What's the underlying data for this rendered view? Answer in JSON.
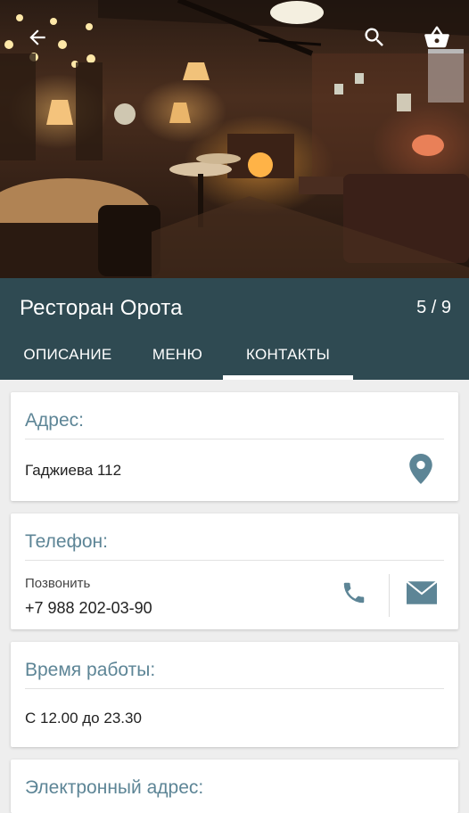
{
  "hero": {
    "back_icon": "arrow-left-icon",
    "search_icon": "search-icon",
    "basket_icon": "basket-icon"
  },
  "appbar": {
    "title": "Ресторан Орота",
    "counter": "5 / 9",
    "background": "#2f4a52"
  },
  "tabs": [
    {
      "label": "ОПИСАНИЕ"
    },
    {
      "label": "МЕНЮ"
    },
    {
      "label": "КОНТАКТЫ",
      "selected": true
    }
  ],
  "contacts": {
    "address": {
      "heading": "Адрес:",
      "value": "Гаджиева 112",
      "icon": "map-pin-icon"
    },
    "phone": {
      "heading": "Телефон:",
      "hint": "Позвонить",
      "value": "+7 988 202-03-90",
      "call_icon": "phone-icon",
      "message_icon": "envelope-icon"
    },
    "hours": {
      "heading": "Время работы:",
      "value": "С 12.00 до 23.30"
    },
    "email": {
      "heading": "Электронный адрес:"
    }
  },
  "accent_color": "#5d8596"
}
